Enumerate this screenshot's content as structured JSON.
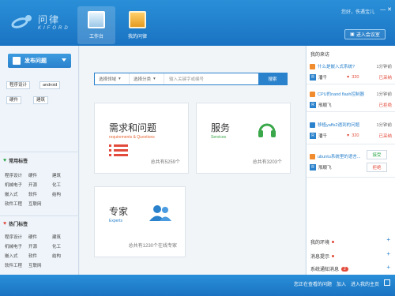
{
  "header": {
    "logo_cn": "问律",
    "logo_en": "KIFORD",
    "tabs": [
      {
        "label": "工作台",
        "active": true
      },
      {
        "label": "我的问律",
        "active": false
      }
    ],
    "greeting": "您好，佚遇宝儿",
    "enter_center": "进入会议室",
    "window_controls": "— ✕"
  },
  "sidebar": {
    "publish": "发布问题",
    "top_tags": [
      "程序设计",
      "android",
      "硬件",
      "建筑"
    ],
    "common_title": "常用标签",
    "common_tags": [
      "程序设计",
      "硬件",
      "建筑",
      "机械电子",
      "开源",
      "化工",
      "嵌入式",
      "软件",
      "结构",
      "软件工程",
      "互联网"
    ],
    "hot_title": "热门标签",
    "hot_tags": [
      "程序设计",
      "硬件",
      "建筑",
      "机械电子",
      "开源",
      "化工",
      "嵌入式",
      "软件",
      "结构",
      "软件工程",
      "互联网"
    ]
  },
  "search": {
    "field1": "选择领域",
    "field2": "选择分类",
    "placeholder": "输入关键字或编号",
    "button": "搜索"
  },
  "cards": {
    "qa": {
      "title": "需求和问题",
      "subtitle": "requirements & Questions",
      "count": "总共有5259个"
    },
    "services": {
      "title": "服务",
      "subtitle": "Services",
      "count": "总共有3203个"
    },
    "experts": {
      "title": "专家",
      "subtitle": "Experts",
      "count": "总共有1230个在线专家"
    }
  },
  "right": {
    "title": "我的来访",
    "items": [
      {
        "q": "什么是嵌入式系统?",
        "time": "1分钟前",
        "user": "潘千",
        "score": "320",
        "status": "已采纳"
      },
      {
        "q": "CPU的nand flash控制器",
        "time": "1分钟前",
        "user": "邢顺飞",
        "score": "",
        "status": "已拒绝"
      },
      {
        "q": "移植yaffs2遇到的问题",
        "time": "1分钟前",
        "user": "潘千",
        "score": "320",
        "status": "已采纳"
      },
      {
        "q": "ubuntu系统里的语言...",
        "time": "",
        "user": "邢顺飞",
        "score": "",
        "status": ""
      }
    ],
    "accept": "接受",
    "reject": "拒绝",
    "my_work": "我的环境",
    "msg_label": "消息提示",
    "sys_label": "系统通知消息",
    "sys_badge": "2"
  },
  "footer": {
    "link1": "您正在查看的问题",
    "link2": "加入",
    "link3": "进入我的主页"
  }
}
